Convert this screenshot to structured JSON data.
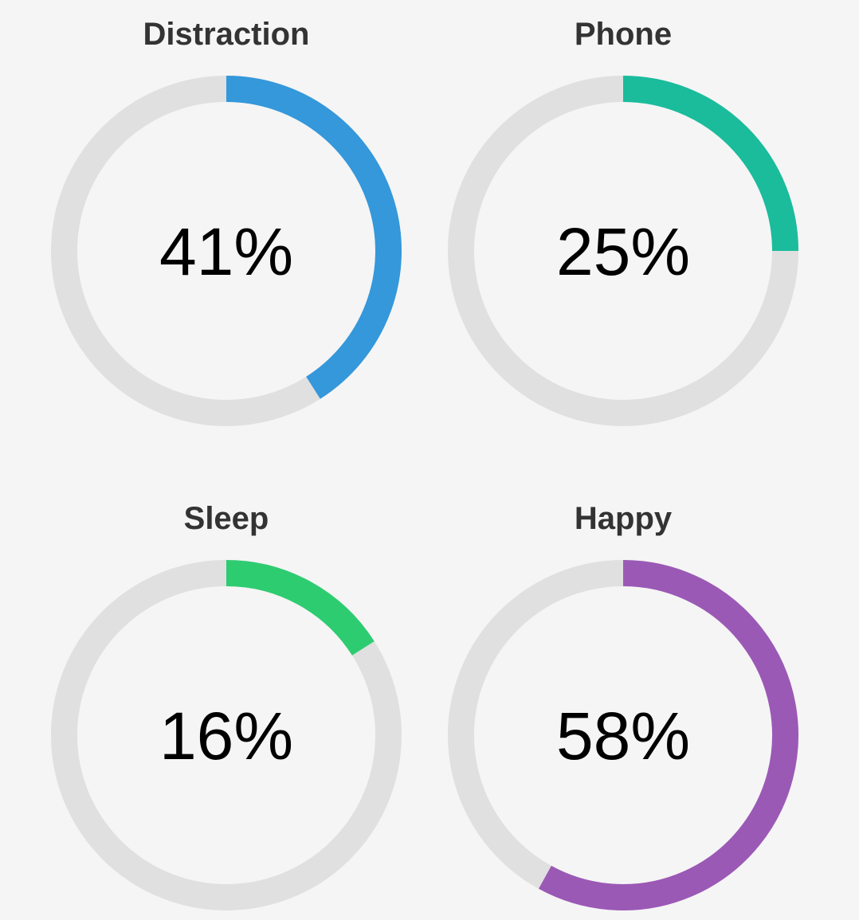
{
  "chart_data": [
    {
      "type": "donut",
      "title": "Distraction",
      "value": 41,
      "value_label": "41%",
      "color": "#3498db",
      "track_color": "#e0e0e0"
    },
    {
      "type": "donut",
      "title": "Phone",
      "value": 25,
      "value_label": "25%",
      "color": "#1abc9c",
      "track_color": "#e0e0e0"
    },
    {
      "type": "donut",
      "title": "Sleep",
      "value": 16,
      "value_label": "16%",
      "color": "#2ecc71",
      "track_color": "#e0e0e0"
    },
    {
      "type": "donut",
      "title": "Happy",
      "value": 58,
      "value_label": "58%",
      "color": "#9b59b6",
      "track_color": "#e0e0e0"
    }
  ]
}
